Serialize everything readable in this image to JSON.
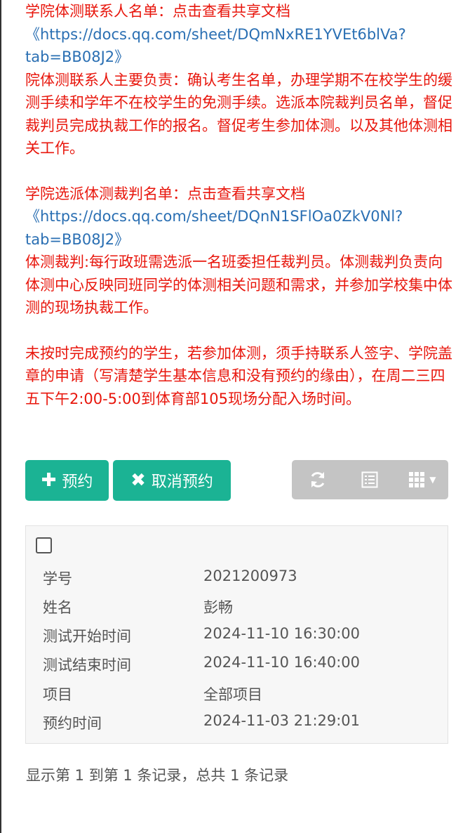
{
  "notices": {
    "college_contact_title": "学院体测联系人名单：点击查看共享文档",
    "college_contact_link": "《https://docs.qq.com/sheet/DQmNxRE1YVEt6blVa?tab=BB08J2》",
    "college_contact_duty": "院体测联系人主要负责：确认考生名单，办理学期不在校学生的缓测手续和学年不在校学生的免测手续。选派本院裁判员名单，督促裁判员完成执裁工作的报名。督促考生参加体测。以及其他体测相关工作。",
    "referee_title": "学院选派体测裁判名单：点击查看共享文档",
    "referee_link": "《https://docs.qq.com/sheet/DQnN1SFlOa0ZkV0Nl?tab=BB08J2》",
    "referee_duty": "体测裁判:每行政班需选派一名班委担任裁判员。体测裁判负责向体测中心反映同班同学的体测相关问题和需求，并参加学校集中体测的现场执裁工作。",
    "late_notice": "未按时完成预约的学生，若参加体测，须手持联系人签字、学院盖章的申请（写清楚学生基本信息和没有预约的缘由），在周二三四五下午2:00-5:00到体育部105现场分配入场时间。"
  },
  "toolbar": {
    "add_label": "预约",
    "cancel_label": "取消预约",
    "add_icon": "plus-icon",
    "cancel_icon": "x-icon",
    "refresh_icon": "refresh-icon",
    "list_icon": "list-view-icon",
    "columns_icon": "grid-columns-icon"
  },
  "record": {
    "fields": [
      {
        "label": "学号",
        "value": "2021200973"
      },
      {
        "label": "姓名",
        "value": "彭畅"
      },
      {
        "label": "测试开始时间",
        "value": "2024-11-10 16:30:00"
      },
      {
        "label": "测试结束时间",
        "value": "2024-11-10 16:40:00"
      },
      {
        "label": "项目",
        "value": "全部项目"
      },
      {
        "label": "预约时间",
        "value": "2024-11-03 21:29:01"
      }
    ]
  },
  "pagination": {
    "summary": "显示第 1 到第 1 条记录，总共 1 条记录"
  },
  "colors": {
    "notice_red": "#e8160c",
    "link_blue": "#2a6fb3",
    "primary_green": "#1bb394",
    "toolbar_gray": "#c4c4c4"
  }
}
